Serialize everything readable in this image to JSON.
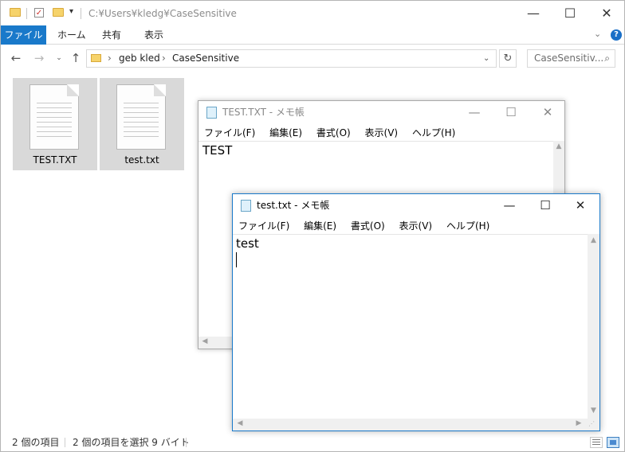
{
  "explorer": {
    "title_path": "C:¥Users¥kledg¥CaseSensitive",
    "window_controls": {
      "minimize": "—",
      "maximize": "☐",
      "close": "✕"
    },
    "ribbon_tabs": {
      "file": "ファイル",
      "home": "ホーム",
      "share": "共有",
      "view": "表示"
    },
    "breadcrumbs": [
      "geb kled",
      "CaseSensitive"
    ],
    "search_placeholder": "CaseSensitiv...",
    "files": [
      {
        "name": "TEST.TXT"
      },
      {
        "name": "test.txt"
      }
    ],
    "status": {
      "items": "2 個の項目",
      "selected": "2 個の項目を選択  9 バイト"
    }
  },
  "notepad_upper": {
    "title": "TEST.TXT - メモ帳",
    "menu": [
      "ファイル(F)",
      "編集(E)",
      "書式(O)",
      "表示(V)",
      "ヘルプ(H)"
    ],
    "content": "TEST"
  },
  "notepad_lower": {
    "title": "test.txt - メモ帳",
    "menu": [
      "ファイル(F)",
      "編集(E)",
      "書式(O)",
      "表示(V)",
      "ヘルプ(H)"
    ],
    "content": "test"
  },
  "colors": {
    "accent": "#1979ca",
    "tile_selected": "#d9d9d9",
    "active_border": "#1979ca"
  }
}
